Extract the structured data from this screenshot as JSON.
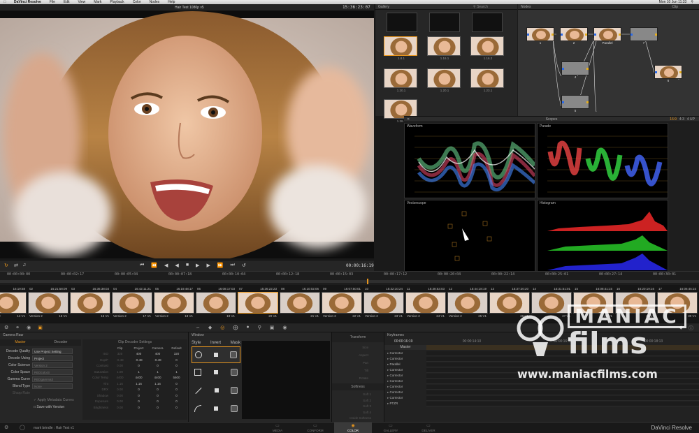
{
  "menubar": {
    "items": [
      "DaVinci Resolve",
      "File",
      "Edit",
      "View",
      "Mark",
      "Playback",
      "Color",
      "Nodes",
      "Help"
    ],
    "clock": "Mon 10 Jun 11:33"
  },
  "viewer": {
    "title": "Hair Test 1080p v5",
    "timecode": "15:36:23:07",
    "playhead_timecode": "00:00:16:19"
  },
  "gallery": {
    "title": "Gallery",
    "search_placeholder": "Search",
    "stills": [
      {
        "label": "1.8.1"
      },
      {
        "label": "1.16.1"
      },
      {
        "label": "1.16.2"
      },
      {
        "label": "1.20.1"
      },
      {
        "label": "1.20.1"
      },
      {
        "label": "1.23.1"
      },
      {
        "label": "1.26.1"
      }
    ]
  },
  "nodes": {
    "title": "Nodes",
    "mode": "Clip",
    "items": [
      {
        "label": "1"
      },
      {
        "label": "2"
      },
      {
        "label": "Parallel"
      },
      {
        "label": "7"
      },
      {
        "label": "4"
      },
      {
        "label": "5"
      },
      {
        "label": "6"
      }
    ]
  },
  "scopes": {
    "title": "Scopes",
    "layout_options": [
      "16:9",
      "4:3",
      "4 UP"
    ],
    "waveform_label": "Waveform",
    "parade_label": "Parade",
    "vectorscope_label": "Vectorscope",
    "histogram_label": "Histogram"
  },
  "ruler": {
    "times": [
      "00:00:00:00",
      "00:00:02:17",
      "00:00:05:04",
      "00:00:07:18",
      "00:00:10:04",
      "00:00:12:18",
      "00:00:15:03",
      "00:00:17:12",
      "00:00:20:04",
      "00:00:22:14",
      "00:00:25:01",
      "00:00:27:14",
      "00:00:30:01"
    ]
  },
  "clips": [
    {
      "tc": "16:19:58",
      "num": "",
      "version": "Version 2",
      "track": "14 V1"
    },
    {
      "tc": "16:21:58:09",
      "num": "02",
      "version": "Version 2",
      "track": "15 V1"
    },
    {
      "tc": "16:36:38:03",
      "num": "03",
      "version": "",
      "track": "16 V1"
    },
    {
      "tc": "16:42:11:21",
      "num": "04",
      "version": "Version 2",
      "track": "17 V1"
    },
    {
      "tc": "16:19:48:17",
      "num": "05",
      "version": "Version 2",
      "track": "18 V1"
    },
    {
      "tc": "16:08:17:03",
      "num": "06",
      "version": "",
      "track": "19 V1"
    },
    {
      "tc": "15:36:22:23",
      "num": "07",
      "version": "",
      "track": "20 V1"
    },
    {
      "tc": "16:10:02:06",
      "num": "08",
      "version": "",
      "track": "21 V1"
    },
    {
      "tc": "16:07:50:01",
      "num": "09",
      "version": "Version 2",
      "track": "22 V1"
    },
    {
      "tc": "15:32:10:24",
      "num": "10",
      "version": "Version 2",
      "track": "23 V1"
    },
    {
      "tc": "15:38:53:03",
      "num": "11",
      "version": "Version 2",
      "track": "24 V1"
    },
    {
      "tc": "15:44:18:19",
      "num": "12",
      "version": "Version 2",
      "track": "25 V1"
    },
    {
      "tc": "15:37:20:20",
      "num": "13",
      "version": "",
      "track": "26 V1"
    },
    {
      "tc": "15:31:51:01",
      "num": "14",
      "version": "",
      "track": "27 V1"
    },
    {
      "tc": "16:08:41:15",
      "num": "15",
      "version": "",
      "track": "28 V1"
    },
    {
      "tc": "16:20:19:16",
      "num": "16",
      "version": "",
      "track": "29 V1"
    },
    {
      "tc": "16:06:45:15",
      "num": "17",
      "version": "",
      "track": "30 V1"
    }
  ],
  "camera_raw": {
    "title": "Camera Raw",
    "tabs": [
      "Master",
      "Decoder"
    ],
    "decode_quality_label": "Decode Quality",
    "decode_quality_value": "Use Project Setting",
    "decode_using_label": "Decode Using",
    "decode_using_value": "Project",
    "color_science_label": "Color Science",
    "color_science_value": "Version 2",
    "color_space_label": "Color Space",
    "color_space_value": "REDcolor3",
    "gamma_curve_label": "Gamma Curve",
    "gamma_curve_value": "REDgamma3",
    "blend_type_label": "Blend Type",
    "blend_type_value": "None",
    "sharpness_label": "Sharp Rate",
    "apply_label": "Apply Metadata Curves",
    "save_label": "Save with Version",
    "decoder_title": "Clip Decoder Settings",
    "columns": [
      "Clip",
      "Project",
      "Camera",
      "Default"
    ],
    "rows": [
      {
        "label": "ISO",
        "values": [
          "320",
          "400",
          "400",
          "320"
        ]
      },
      {
        "label": "Exp/F",
        "values": [
          "-0.48",
          "-0.48",
          "-0.48",
          "0"
        ]
      },
      {
        "label": "Contrast",
        "values": [
          "0.00",
          "0",
          "0",
          "0"
        ]
      },
      {
        "label": "Saturation",
        "values": [
          "1.00",
          "1",
          "1",
          "1"
        ]
      },
      {
        "label": "Color Temp",
        "values": [
          "4400",
          "4400",
          "4400",
          "5600"
        ]
      },
      {
        "label": "Tint",
        "values": [
          "1.16",
          "1.16",
          "1.16",
          "0"
        ]
      },
      {
        "label": "DRX",
        "values": [
          "0.00",
          "0",
          "0",
          "0"
        ]
      },
      {
        "label": "Shadow",
        "values": [
          "0.00",
          "0",
          "0",
          "0"
        ]
      },
      {
        "label": "Exposure",
        "values": [
          "0.00",
          "0",
          "0",
          "0"
        ]
      },
      {
        "label": "Brightness",
        "values": [
          "0.00",
          "0",
          "0",
          "0"
        ]
      }
    ]
  },
  "window": {
    "title": "Window",
    "columns": [
      "Style",
      "Invert",
      "Mask"
    ]
  },
  "transform": {
    "title": "Transform",
    "fields": [
      "Size",
      "Aspect",
      "Pan",
      "Tilt",
      "Rotate"
    ],
    "softness_title": "Softness",
    "softness_fields": [
      "Soft 1",
      "Soft 2",
      "Soft 3",
      "Soft 4",
      "Inside Softness",
      "Outside Softness"
    ]
  },
  "keyframes": {
    "title": "Keyframes",
    "timecodes": [
      "00:00:16:19",
      "00:00:14:10",
      "00:00:16:12",
      "00:00:18:13"
    ],
    "master_label": "Master",
    "tracks": [
      "Corrector",
      "Corrector",
      "Parallel",
      "Corrector",
      "Corrector",
      "Corrector",
      "Corrector",
      "Corrector",
      "Corrector",
      "PTZR"
    ]
  },
  "status": {
    "user": "mark brindle",
    "project": "Hair Test v1",
    "pages": [
      "MEDIA",
      "CONFORM",
      "COLOR",
      "GALLERY",
      "DELIVER"
    ],
    "active_page": "COLOR",
    "brand": "DaVinci Resolve"
  },
  "watermark": {
    "brand_word": "MANIAC",
    "brand_word2": "films",
    "url": "www.maniacfilms.com"
  },
  "colors": {
    "accent_orange": "#e8961e",
    "active_page_bg": "#3a3a3a"
  }
}
